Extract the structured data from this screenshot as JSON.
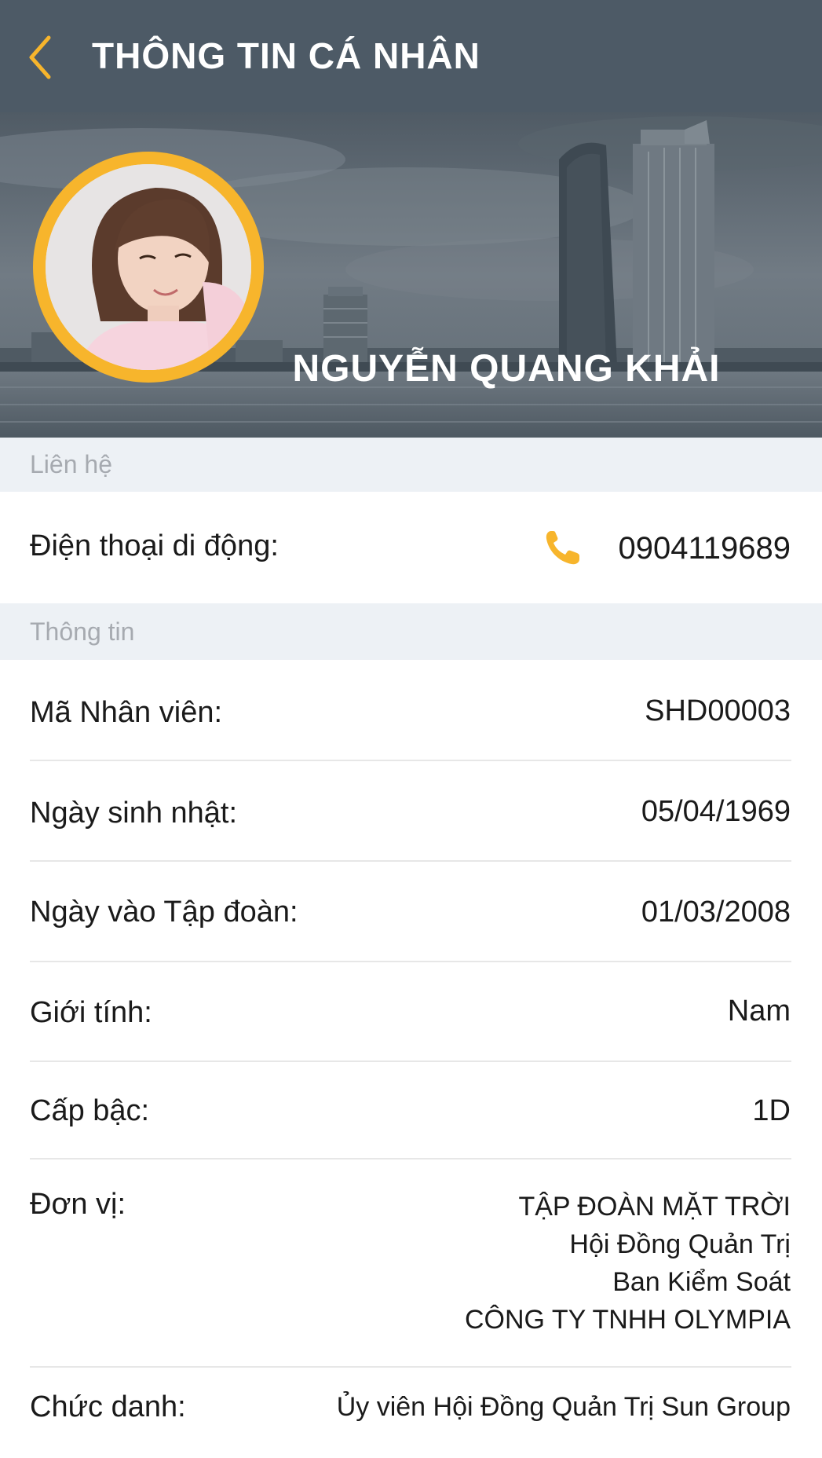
{
  "header": {
    "title": "THÔNG TIN CÁ NHÂN",
    "back_icon": "chevron-left-icon"
  },
  "profile": {
    "name": "NGUYỄN QUANG KHẢI"
  },
  "sections": {
    "contact": "Liên hệ",
    "info": "Thông tin"
  },
  "contact": {
    "phone_label": "Điện thoại di động:",
    "phone_value": "0904119689",
    "phone_icon": "phone-icon"
  },
  "info": {
    "employee_id_label": "Mã Nhân viên:",
    "employee_id_value": "SHD00003",
    "birthday_label": "Ngày sinh nhật:",
    "birthday_value": "05/04/1969",
    "join_date_label": "Ngày vào Tập đoàn:",
    "join_date_value": "01/03/2008",
    "gender_label": "Giới tính:",
    "gender_value": "Nam",
    "rank_label": "Cấp bậc:",
    "rank_value": "1D",
    "unit_label": "Đơn vị:",
    "unit_values": [
      "TẬP ĐOÀN MẶT TRỜI",
      "Hội Đồng Quản Trị",
      "Ban Kiểm Soát",
      "CÔNG TY TNHH OLYMPIA"
    ],
    "title_label": "Chức danh:",
    "title_value": "Ủy viên Hội Đồng Quản Trị Sun Group"
  },
  "colors": {
    "header_bg": "#4d5a66",
    "accent": "#f7b52c",
    "section_bg": "#edf1f5",
    "section_text": "#a6aab0"
  }
}
